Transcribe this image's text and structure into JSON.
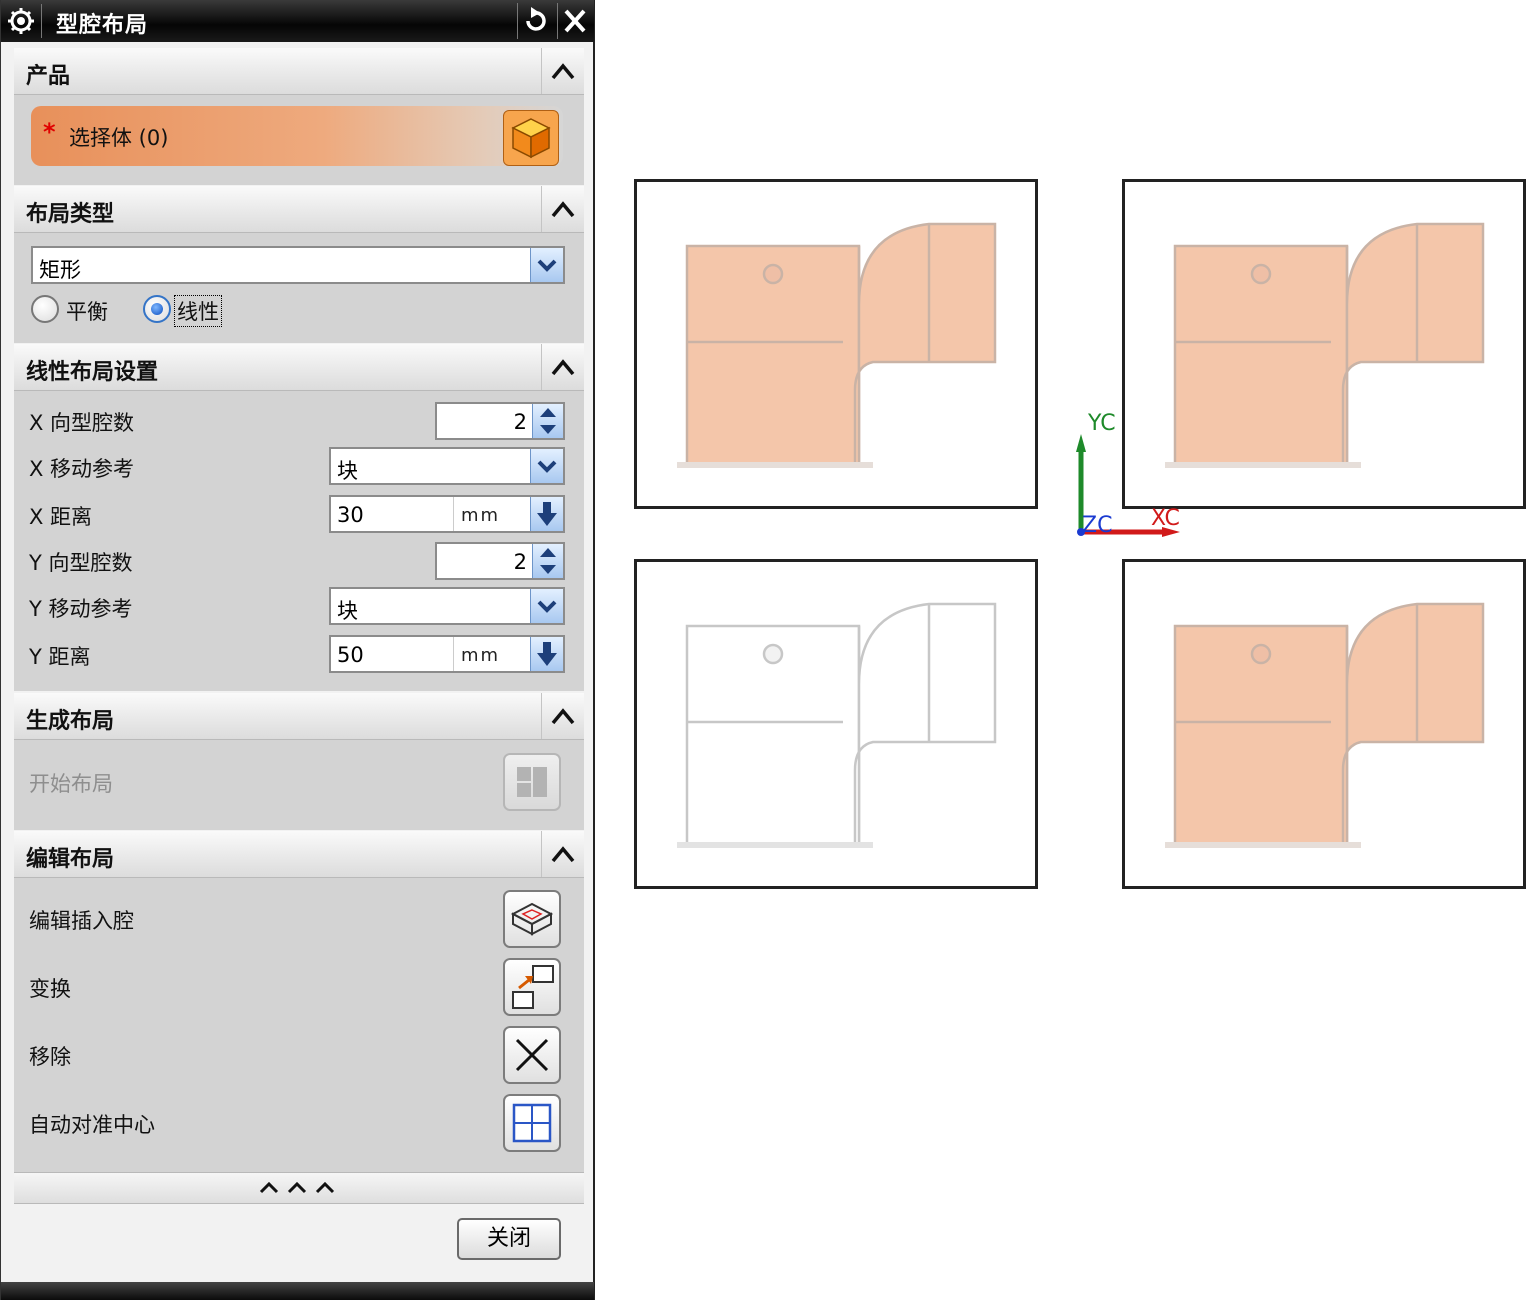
{
  "dialog": {
    "title": "型腔布局",
    "product": {
      "header": "产品",
      "select_required_mark": "*",
      "select_label": "选择体 (0)"
    },
    "layout_type": {
      "header": "布局类型",
      "type_value": "矩形",
      "radio_balance": "平衡",
      "radio_linear": "线性",
      "selected_radio": "线性"
    },
    "linear_settings": {
      "header": "线性布局设置",
      "x_count_label": "X 向型腔数",
      "x_count_value": "2",
      "x_ref_label": "X 移动参考",
      "x_ref_value": "块",
      "x_dist_label": "X 距离",
      "x_dist_value": "30",
      "x_dist_unit": "mm",
      "y_count_label": "Y 向型腔数",
      "y_count_value": "2",
      "y_ref_label": "Y 移动参考",
      "y_ref_value": "块",
      "y_dist_label": "Y 距离",
      "y_dist_value": "50",
      "y_dist_unit": "mm"
    },
    "generate": {
      "header": "生成布局",
      "start_label": "开始布局"
    },
    "edit": {
      "header": "编辑布局",
      "edit_insert_label": "编辑插入腔",
      "transform_label": "变换",
      "remove_label": "移除",
      "auto_center_label": "自动对准中心"
    },
    "close_label": "关闭"
  },
  "graphics": {
    "axis_yc": "YC",
    "axis_xc": "XC",
    "axis_zc": "ZC"
  },
  "colors": {
    "part_fill": "#f4c6aa",
    "axis_x": "#d11a1a",
    "axis_y": "#1e8a2a",
    "axis_z": "#1a3ad1",
    "accent_blue": "#3474c7"
  }
}
